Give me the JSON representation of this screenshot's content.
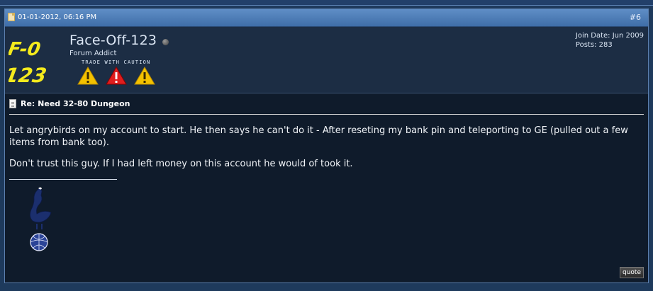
{
  "post": {
    "date": "01-01-2012, 06:16 PM",
    "number": "#6",
    "user": {
      "avatar_text_top": "F-0",
      "avatar_text_bottom": "123",
      "name": "Face-Off-123",
      "title": "Forum Addict",
      "reputation_caption": "TRADE WITH CAUTION",
      "join_date": "Join Date: Jun 2009",
      "posts": "Posts: 283",
      "status": "offline"
    },
    "title": "Re: Need 32-80 Dungeon",
    "body": [
      "Let angrybirds on my account to start. He then says he can't do it - After reseting my bank pin and teleporting to GE (pulled out a few items from bank too).",
      "Don't trust this guy. If I had left money on this account he would of took it."
    ],
    "quote_label": "quote"
  },
  "colors": {
    "header_bar": "#4f7eb9",
    "user_area": "#1c2d44",
    "post_bg": "#0f1b2b",
    "avatar_yellow": "#f4ea1d",
    "warning_yellow": "#f4c200",
    "warning_red": "#e01e1e"
  },
  "icons": [
    "post-icon",
    "status-offline-icon",
    "warning-icon",
    "document-icon",
    "cockerel-signature-image"
  ]
}
